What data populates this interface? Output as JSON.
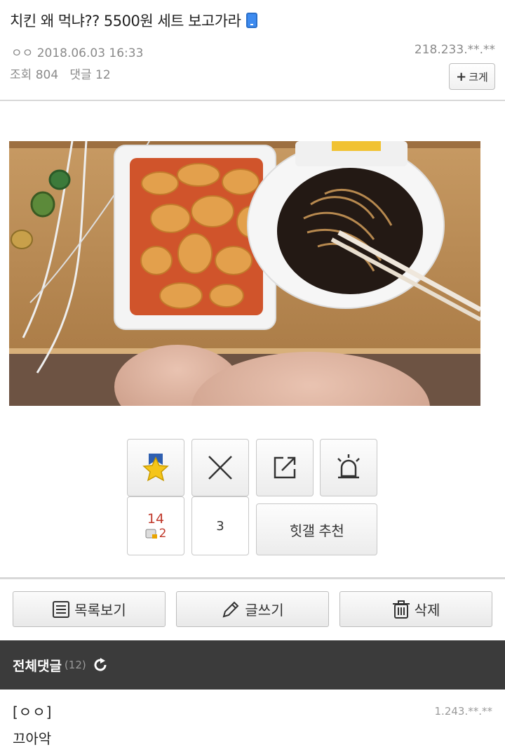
{
  "post": {
    "title": "치킨 왜 먹냐?? 5500원 세트 보고가라",
    "author": "ㅇㅇ",
    "datetime": "2018.06.03 16:33",
    "ip": "218.233.**.**",
    "views_label": "조회",
    "views": "804",
    "comments_label": "댓글",
    "comments": "12",
    "enlarge_label": "크게"
  },
  "votes": {
    "recommend_count": "14",
    "recommend_sub": "2",
    "downvote_count": "3",
    "hitgall_label": "힛갤 추천"
  },
  "actions": {
    "list_label": "목록보기",
    "write_label": "글쓰기",
    "delete_label": "삭제"
  },
  "comment_section": {
    "title": "전체댓글",
    "count": "(12)"
  },
  "comments": [
    {
      "author": "[ㅇㅇ]",
      "ip": "1.243.**.**",
      "text": "끄아악"
    }
  ]
}
